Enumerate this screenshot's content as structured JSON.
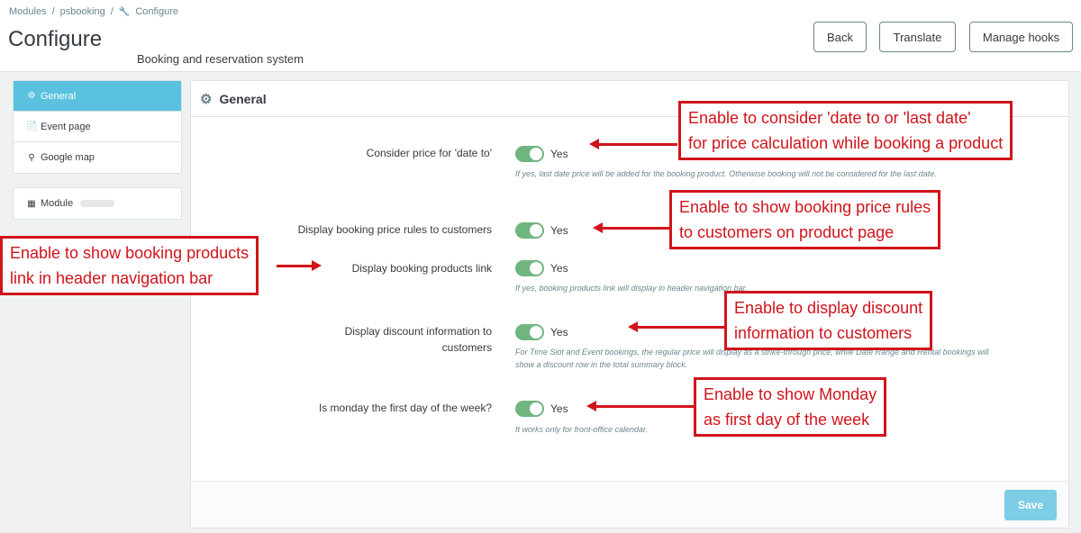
{
  "breadcrumb": [
    "Modules",
    "psbooking",
    "Configure"
  ],
  "header": {
    "title": "Configure",
    "subtitle": "Booking and reservation system",
    "buttons": {
      "back": "Back",
      "translate": "Translate",
      "manage_hooks": "Manage hooks"
    }
  },
  "sidebar": {
    "items": [
      "General",
      "Event page",
      "Google map"
    ],
    "module_label": "Module"
  },
  "panel": {
    "title": "General",
    "save": "Save",
    "rows": [
      {
        "label": "Consider price for 'date to'",
        "value": "Yes",
        "help": "If yes, last date price will be added for the booking product. Otherwise booking will not be considered for the last date."
      },
      {
        "label": "Display booking price rules to customers",
        "value": "Yes",
        "help": ""
      },
      {
        "label": "Display booking products link",
        "value": "Yes",
        "help": "If yes, booking products link will display in header navigation bar."
      },
      {
        "label": "Display discount information to customers",
        "value": "Yes",
        "help": "For Time Slot and Event bookings, the regular price will display as a strike-through price, while Date Range and Rental bookings will show a discount row in the total summary block."
      },
      {
        "label": "Is monday the first day of the week?",
        "value": "Yes",
        "help": "It works only for front-office calendar."
      }
    ]
  },
  "callouts": [
    {
      "line1": "Enable to consider 'date to or 'last date'",
      "line2": "for price calculation while booking a product"
    },
    {
      "line1": "Enable to show booking price rules",
      "line2": "to customers on product page"
    },
    {
      "line1": "Enable to show booking products",
      "line2": "link in header navigation bar"
    },
    {
      "line1": "Enable to display discount",
      "line2": "information to customers"
    },
    {
      "line1": "Enable to show Monday",
      "line2": "as first day of the week"
    }
  ],
  "colors": {
    "accent": "#5ac2df",
    "switch_on": "#70b580",
    "callout": "#d0141b",
    "save": "#7ccde5"
  }
}
